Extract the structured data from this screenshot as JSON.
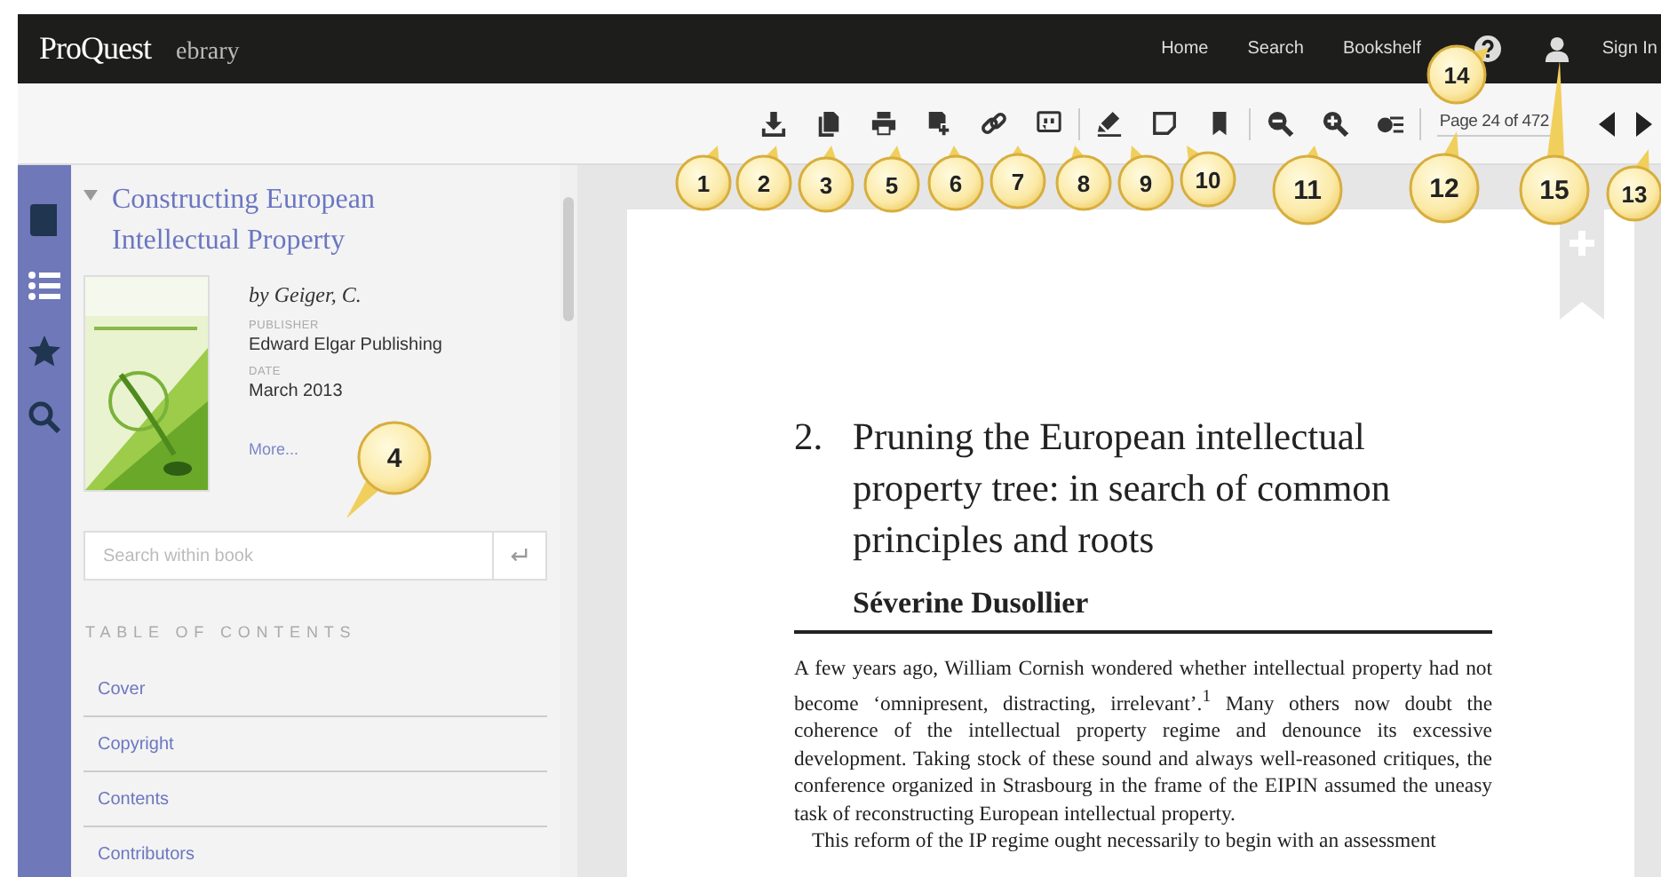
{
  "top_bar": {
    "logo": "ProQuest",
    "product": "ebrary",
    "nav": [
      "Home",
      "Search",
      "Bookshelf"
    ],
    "sign_in": "Sign In"
  },
  "toolbar": {
    "groups": [
      [
        {
          "kind": "download"
        },
        {
          "kind": "copy"
        },
        {
          "kind": "print"
        },
        {
          "kind": "add-page"
        },
        {
          "kind": "link"
        },
        {
          "kind": "quote"
        }
      ],
      [
        {
          "kind": "highlight"
        },
        {
          "kind": "note"
        },
        {
          "kind": "bookmark"
        }
      ],
      [
        {
          "kind": "zoom-out"
        },
        {
          "kind": "zoom-in"
        },
        {
          "kind": "options"
        }
      ]
    ],
    "page_indicator": "Page 24 of 472"
  },
  "rail": [
    {
      "kind": "book",
      "selected": false
    },
    {
      "kind": "list",
      "selected": true
    },
    {
      "kind": "star",
      "selected": false
    },
    {
      "kind": "search",
      "selected": false
    }
  ],
  "sidebar": {
    "title": "Constructing European Intellectual Property",
    "author": "by Geiger, C.",
    "publisher_label": "PUBLISHER",
    "publisher": "Edward Elgar Publishing",
    "date_label": "DATE",
    "date": "March 2013",
    "more": "More...",
    "search": {
      "placeholder": "Search within book"
    },
    "toc_heading": "TABLE OF CONTENTS",
    "toc": [
      "Cover",
      "Copyright",
      "Contents",
      "Contributors"
    ]
  },
  "page": {
    "number": "2.",
    "title": "Pruning the European intellectual property tree: in search of common principles and roots",
    "author": "Séverine Dusollier",
    "paragraphs": [
      "A few years ago, William Cornish wondered whether intellectual property had not become ‘omnipresent, distracting, irrelevant’.$^{1}$ Many others now doubt the coherence of the intellectual property regime and denounce its excessive development. Taking stock of these sound and always well-reasoned critiques, the conference organized in Strasbourg in the frame of the EIPIN assumed the uneasy task of reconstructing European intellectual property.",
      "This reform of the IP regime ought necessarily to begin with an assessment"
    ]
  },
  "callouts": [
    "14",
    "1",
    "2",
    "3",
    "5",
    "6",
    "7",
    "8",
    "9",
    "10",
    "11",
    "12",
    "15",
    "13",
    "4"
  ]
}
